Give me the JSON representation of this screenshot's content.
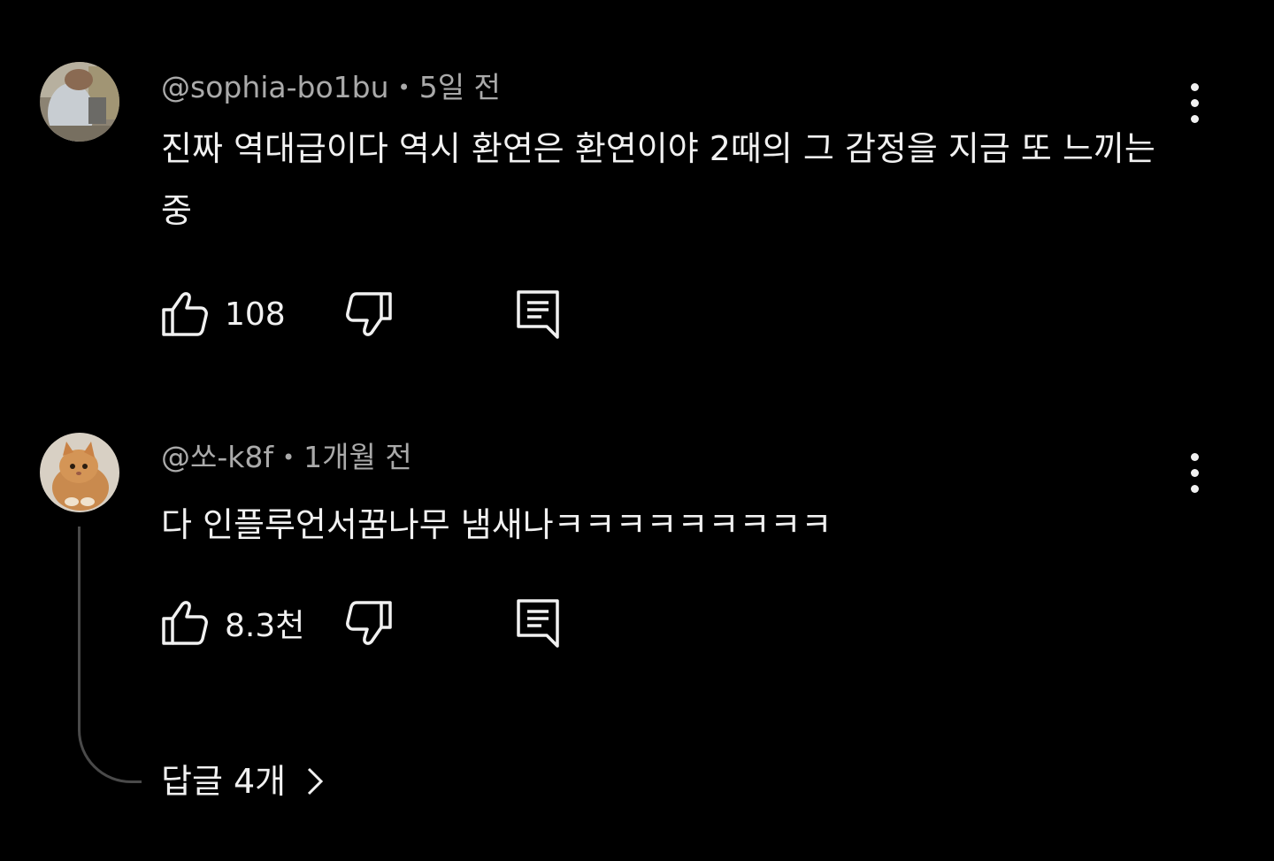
{
  "comments": [
    {
      "author": "@sophia-bo1bu",
      "dot": "•",
      "time": "5일 전",
      "text": "진짜 역대급이다 역시 환연은 환연이야 2때의 그 감정을 지금 또 느끼는중",
      "likes": "108",
      "avatar_icon": "person-photo-avatar",
      "icons": [
        "thumbs-up-icon",
        "thumbs-down-icon",
        "reply-icon",
        "more-vertical-icon"
      ]
    },
    {
      "author": "@쏘-k8f",
      "dot": "•",
      "time": "1개월 전",
      "text": "다 인플루언서꿈나무 냄새나ㅋㅋㅋㅋㅋㅋㅋㅋㅋ",
      "likes": "8.3천",
      "avatar_icon": "cat-photo-avatar",
      "icons": [
        "thumbs-up-icon",
        "thumbs-down-icon",
        "reply-icon",
        "more-vertical-icon"
      ]
    }
  ],
  "replies": {
    "label": "답글 4개",
    "icon": "chevron-right-icon"
  },
  "colors": {
    "background": "#000000",
    "text": "#f1f1f1",
    "meta": "#aaaaaa",
    "thread_line": "#4a4a4a"
  }
}
